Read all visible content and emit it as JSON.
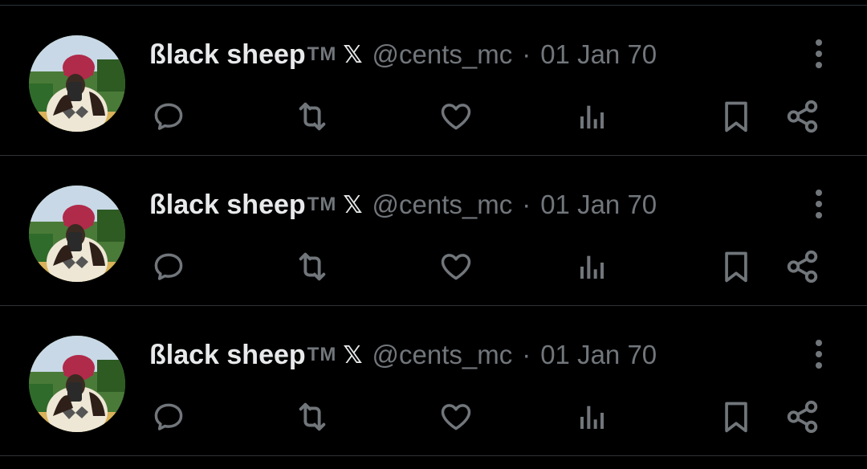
{
  "colors": {
    "background": "#000000",
    "divider": "#2f3336",
    "primary_text": "#e7e9ea",
    "secondary_text": "#71767b",
    "icon": "#71767b"
  },
  "posts": [
    {
      "display_name": "ßlack sheep",
      "tm": "TM",
      "badge": "𝕏",
      "handle": "@cents_mc",
      "separator": "·",
      "date": "01 Jan 70",
      "icons": [
        "reply-icon",
        "repost-icon",
        "like-icon",
        "views-icon",
        "bookmark-icon",
        "share-icon",
        "more-icon"
      ]
    },
    {
      "display_name": "ßlack sheep",
      "tm": "TM",
      "badge": "𝕏",
      "handle": "@cents_mc",
      "separator": "·",
      "date": "01 Jan 70",
      "icons": [
        "reply-icon",
        "repost-icon",
        "like-icon",
        "views-icon",
        "bookmark-icon",
        "share-icon",
        "more-icon"
      ]
    },
    {
      "display_name": "ßlack sheep",
      "tm": "TM",
      "badge": "𝕏",
      "handle": "@cents_mc",
      "separator": "·",
      "date": "01 Jan 70",
      "icons": [
        "reply-icon",
        "repost-icon",
        "like-icon",
        "views-icon",
        "bookmark-icon",
        "share-icon",
        "more-icon"
      ]
    }
  ]
}
